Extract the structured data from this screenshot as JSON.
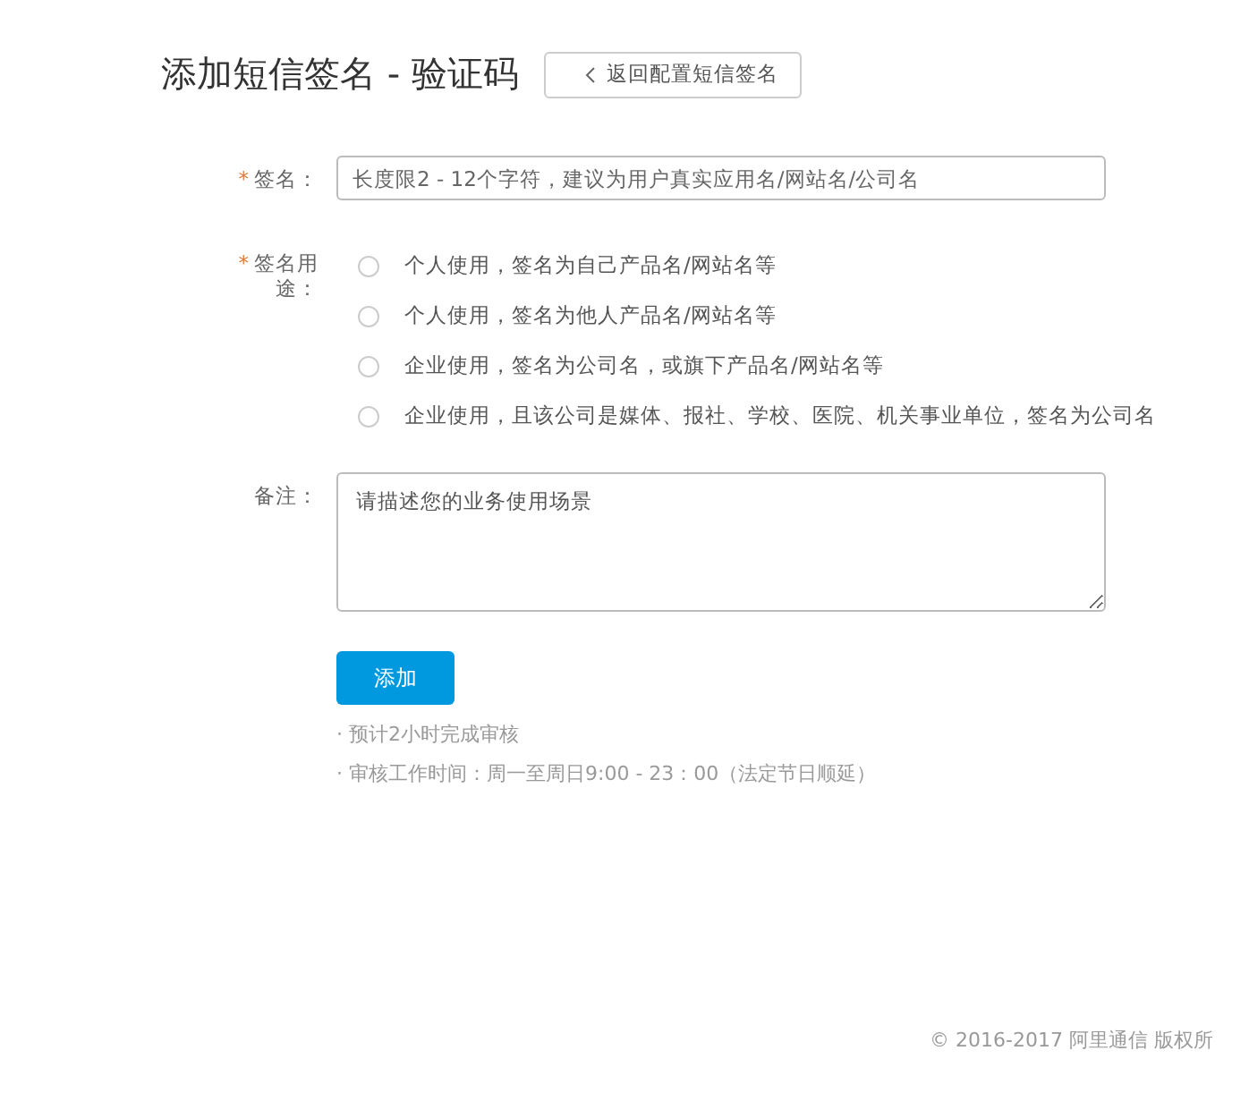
{
  "page": {
    "title": "添加短信签名 - 验证码",
    "back_button": "返回配置短信签名"
  },
  "form": {
    "signature": {
      "label": "签名：",
      "required_mark": "*",
      "placeholder": "长度限2 - 12个字符，建议为用户真实应用名/网站名/公司名"
    },
    "purpose": {
      "label": "签名用途：",
      "required_mark": "*",
      "options": [
        {
          "label": "个人使用，签名为自己产品名/网站名等",
          "selected": false
        },
        {
          "label": "个人使用，签名为他人产品名/网站名等",
          "selected": false
        },
        {
          "label": "企业使用，签名为公司名，或旗下产品名/网站名等",
          "selected": false
        },
        {
          "label": "企业使用，且该公司是媒体、报社、学校、医院、机关事业单位，签名为公司名",
          "selected": false
        }
      ]
    },
    "remark": {
      "label": "备注：",
      "placeholder": "请描述您的业务使用场景"
    },
    "submit": "添加",
    "notes": [
      "· 预计2小时完成审核",
      "· 审核工作时间：周一至周日9:00 - 23：00（法定节日顺延）"
    ]
  },
  "footer": "© 2016-2017 阿里通信 版权所"
}
